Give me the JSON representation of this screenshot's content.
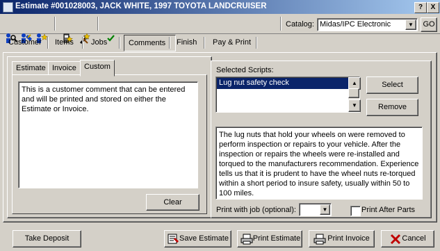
{
  "window": {
    "title": "Estimate #001028003, JACK WHITE, 1997 TOYOTA LANDCRUISER",
    "help_label": "?",
    "close_label": "X"
  },
  "toolbar": {
    "catalog_label": "Catalog:",
    "catalog_value": "Midas/IPC Electronic",
    "go_label": "GO"
  },
  "nav_tabs": [
    "Customer",
    "Items",
    "Jobs",
    "Comments",
    "Finish",
    "Pay & Print"
  ],
  "comments": {
    "tabs": [
      "Estimate",
      "Invoice",
      "Custom"
    ],
    "text": "This is a customer comment that can be entered and will be printed and stored on either the Estimate or Invoice.",
    "clear_label": "Clear"
  },
  "scripts": {
    "label": "Selected Scripts:",
    "items": [
      "Lug nut safety check"
    ],
    "select_label": "Select",
    "remove_label": "Remove",
    "detail_text": "The lug nuts that hold your wheels on were removed to perform inspection or repairs to your vehicle. After the inspection or repairs the wheels were re-installed and torqued to the manufacturers recommendation. Experience tells us that it is prudent to have the wheel nuts re-torqued within a short period to insure safety, usually within 50 to 100 miles.",
    "print_with_job_label": "Print with job (optional):",
    "print_with_job_value": "",
    "print_after_parts_label": "Print After Parts",
    "print_after_parts_checked": false
  },
  "footer": {
    "take_deposit_label": "Take Deposit",
    "save_estimate_label": "Save Estimate",
    "print_estimate_label": "Print Estimate",
    "print_invoice_label": "Print Invoice",
    "cancel_label": "Cancel"
  },
  "colors": {
    "title_start": "#0a246a",
    "title_end": "#a6caf0",
    "selection": "#0a246a",
    "check_green": "#008000",
    "cancel_red": "#c00000"
  }
}
